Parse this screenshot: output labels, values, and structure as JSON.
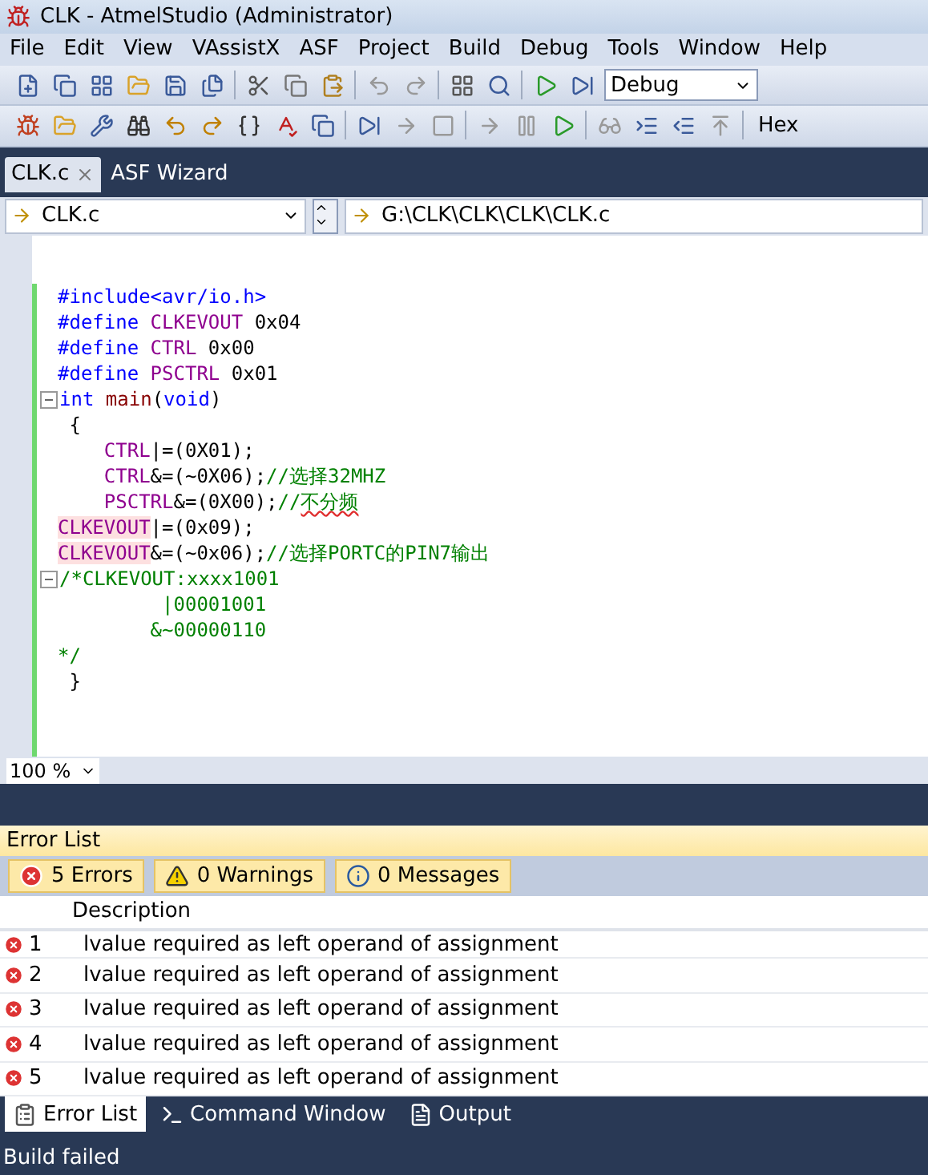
{
  "window": {
    "title": "CLK - AtmelStudio (Administrator)"
  },
  "menu": [
    "File",
    "Edit",
    "View",
    "VAssistX",
    "ASF",
    "Project",
    "Build",
    "Debug",
    "Tools",
    "Window",
    "Help"
  ],
  "toolbar": {
    "configuration": "Debug",
    "hex_button": "Hex"
  },
  "tabs": [
    {
      "label": "CLK.c",
      "selected": true,
      "closable": true
    },
    {
      "label": "ASF Wizard",
      "selected": false,
      "closable": false
    }
  ],
  "navigation": {
    "file": "CLK.c",
    "path": "G:\\CLK\\CLK\\CLK\\CLK.c"
  },
  "code_lines": [
    {
      "fold": false,
      "tokens": [
        {
          "text": "#include<avr/io.h>",
          "kind": "directive"
        }
      ]
    },
    {
      "fold": false,
      "tokens": [
        {
          "text": "#define ",
          "kind": "directive"
        },
        {
          "text": "CLKEVOUT",
          "kind": "macro"
        },
        {
          "text": " 0x04",
          "kind": "plain"
        }
      ]
    },
    {
      "fold": false,
      "tokens": [
        {
          "text": "#define ",
          "kind": "directive"
        },
        {
          "text": "CTRL",
          "kind": "macro"
        },
        {
          "text": " 0x00",
          "kind": "plain"
        }
      ]
    },
    {
      "fold": false,
      "tokens": [
        {
          "text": "#define ",
          "kind": "directive"
        },
        {
          "text": "PSCTRL",
          "kind": "macro"
        },
        {
          "text": " 0x01",
          "kind": "plain"
        }
      ]
    },
    {
      "fold": true,
      "tokens": [
        {
          "text": "int ",
          "kind": "keyword"
        },
        {
          "text": "main",
          "kind": "function"
        },
        {
          "text": "(",
          "kind": "plain"
        },
        {
          "text": "void",
          "kind": "keyword"
        },
        {
          "text": ")",
          "kind": "plain"
        }
      ]
    },
    {
      "fold": false,
      "tokens": [
        {
          "text": " {",
          "kind": "plain"
        }
      ]
    },
    {
      "fold": false,
      "tokens": [
        {
          "text": "    CTRL",
          "kind": "macro"
        },
        {
          "text": "|=(0X01);",
          "kind": "plain"
        }
      ]
    },
    {
      "fold": false,
      "tokens": [
        {
          "text": "    CTRL",
          "kind": "macro"
        },
        {
          "text": "&=(~0X06);",
          "kind": "plain"
        },
        {
          "text": "//选择32MHZ",
          "kind": "comment"
        }
      ]
    },
    {
      "fold": false,
      "tokens": [
        {
          "text": "    PSCTRL",
          "kind": "macro"
        },
        {
          "text": "&=(0X00);",
          "kind": "plain"
        },
        {
          "text": "//",
          "kind": "comment"
        },
        {
          "text": "不分频",
          "kind": "misspelled"
        }
      ]
    },
    {
      "fold": false,
      "tokens": [
        {
          "text": "CLKEVOUT",
          "kind": "error"
        },
        {
          "text": "|=(0x09);",
          "kind": "plain"
        }
      ]
    },
    {
      "fold": false,
      "tokens": [
        {
          "text": "CLKEVOUT",
          "kind": "error"
        },
        {
          "text": "&=(~0x06);",
          "kind": "plain"
        },
        {
          "text": "//选择PORTC的PIN7输出",
          "kind": "comment"
        }
      ]
    },
    {
      "fold": true,
      "tokens": [
        {
          "text": "/*CLKEVOUT:xxxx1001",
          "kind": "comment"
        }
      ]
    },
    {
      "fold": false,
      "tokens": [
        {
          "text": "         |00001001",
          "kind": "comment"
        }
      ]
    },
    {
      "fold": false,
      "tokens": [
        {
          "text": "        &~00000110",
          "kind": "comment"
        }
      ]
    },
    {
      "fold": false,
      "tokens": [
        {
          "text": "*/",
          "kind": "comment"
        }
      ]
    },
    {
      "fold": false,
      "tokens": [
        {
          "text": " }",
          "kind": "plain"
        }
      ]
    }
  ],
  "zoom": "100 %",
  "error_list": {
    "title": "Error List",
    "filters": [
      {
        "kind": "error",
        "label": "5 Errors",
        "selected": true
      },
      {
        "kind": "warning",
        "label": "0 Warnings",
        "selected": true
      },
      {
        "kind": "info",
        "label": "0 Messages",
        "selected": true
      }
    ],
    "column": "Description",
    "rows": [
      {
        "number": "1",
        "description": "lvalue required as left operand of assignment"
      },
      {
        "number": "2",
        "description": "lvalue required as left operand of assignment"
      },
      {
        "number": "3",
        "description": "lvalue required as left operand of assignment"
      },
      {
        "number": "4",
        "description": "lvalue required as left operand of assignment"
      },
      {
        "number": "5",
        "description": "lvalue required as left operand of assignment"
      }
    ]
  },
  "bottom_tabs": [
    {
      "kind": "errors",
      "label": "Error List",
      "selected": true
    },
    {
      "kind": "command",
      "label": "Command Window",
      "selected": false
    },
    {
      "kind": "output",
      "label": "Output",
      "selected": false
    }
  ],
  "status_bar": "Build failed"
}
